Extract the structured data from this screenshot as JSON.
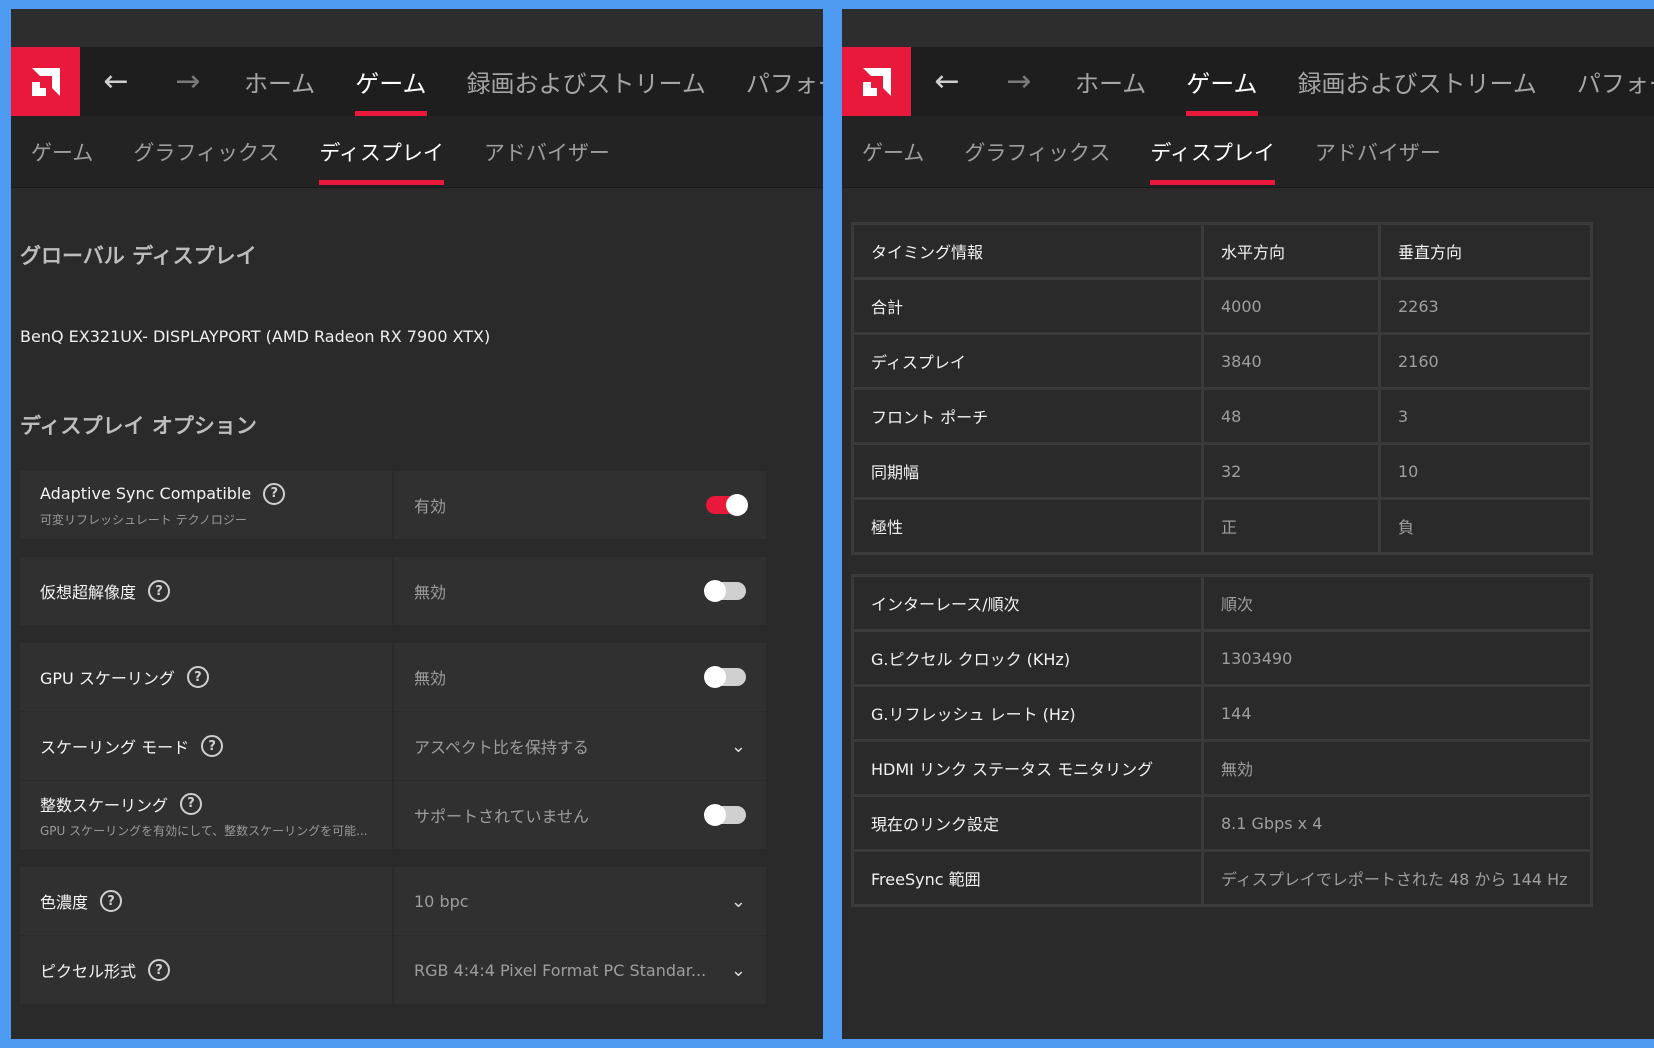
{
  "colors": {
    "accent": "#e8193a",
    "background": "#4e9af0",
    "panel": "#2a2a2a"
  },
  "topnav": {
    "back_icon": "arrow-left-icon",
    "forward_icon": "arrow-right-icon",
    "items": [
      {
        "label": "ホーム",
        "active": false
      },
      {
        "label": "ゲーム",
        "active": true
      },
      {
        "label": "録画およびストリーム",
        "active": false
      },
      {
        "label": "パフォーマンス",
        "active": false
      }
    ]
  },
  "subnav": {
    "items": [
      {
        "label": "ゲーム",
        "active": false
      },
      {
        "label": "グラフィックス",
        "active": false
      },
      {
        "label": "ディスプレイ",
        "active": true
      },
      {
        "label": "アドバイザー",
        "active": false
      }
    ]
  },
  "left": {
    "section_global": "グローバル ディスプレイ",
    "monitor": "BenQ EX321UX- DISPLAYPORT (AMD Radeon RX 7900 XTX)",
    "section_options": "ディスプレイ オプション",
    "settings": [
      {
        "label": "Adaptive Sync Compatible",
        "sublabel": "可変リフレッシュレート テクノロジー",
        "value": "有効",
        "control": "toggle",
        "on": true
      },
      {
        "label": "仮想超解像度",
        "sublabel": "",
        "value": "無効",
        "control": "toggle",
        "on": false
      },
      {
        "label": "GPU スケーリング",
        "sublabel": "",
        "value": "無効",
        "control": "toggle",
        "on": false
      },
      {
        "label": "スケーリング モード",
        "sublabel": "",
        "value": "アスペクト比を保持する",
        "control": "dropdown"
      },
      {
        "label": "整数スケーリング",
        "sublabel": "GPU スケーリングを有効にして、整数スケーリングを可能...",
        "value": "サポートされていません",
        "control": "toggle",
        "on": false
      },
      {
        "label": "色濃度",
        "sublabel": "",
        "value": "10 bpc",
        "control": "dropdown"
      },
      {
        "label": "ピクセル形式",
        "sublabel": "",
        "value": "RGB 4:4:4 Pixel Format PC Standar...",
        "control": "dropdown"
      }
    ]
  },
  "right": {
    "timing_table": {
      "headers": [
        "タイミング情報",
        "水平方向",
        "垂直方向"
      ],
      "rows": [
        [
          "合計",
          "4000",
          "2263"
        ],
        [
          "ディスプレイ",
          "3840",
          "2160"
        ],
        [
          "フロント ポーチ",
          "48",
          "3"
        ],
        [
          "同期幅",
          "32",
          "10"
        ],
        [
          "極性",
          "正",
          "負"
        ]
      ]
    },
    "info_table": {
      "rows": [
        [
          "インターレース/順次",
          "順次"
        ],
        [
          "G.ピクセル クロック (KHz)",
          "1303490"
        ],
        [
          "G.リフレッシュ レート (Hz)",
          "144"
        ],
        [
          "HDMI リンク ステータス モニタリング",
          "無効"
        ],
        [
          "現在のリンク設定",
          "8.1 Gbps x 4"
        ],
        [
          "FreeSync 範囲",
          "ディスプレイでレポートされた 48 から 144 Hz"
        ]
      ]
    }
  }
}
